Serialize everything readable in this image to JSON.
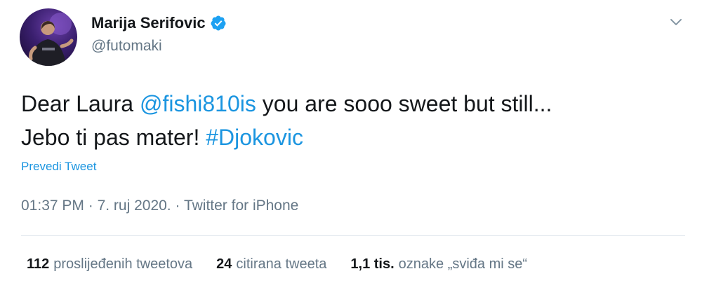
{
  "author": {
    "display_name": "Marija Serifovic",
    "handle": "@futomaki",
    "verified": true
  },
  "tweet": {
    "text_parts": [
      {
        "text": "Dear Laura ",
        "type": "text"
      },
      {
        "text": "@fishi810is",
        "type": "mention"
      },
      {
        "text": " you are sooo sweet but still...",
        "type": "text"
      },
      {
        "text": "Jebo ti pas mater! ",
        "type": "text"
      },
      {
        "text": "#Djokovic",
        "type": "hashtag"
      }
    ],
    "translate_label": "Prevedi Tweet",
    "time": "01:37 PM",
    "date": "7. ruj 2020.",
    "source": "Twitter for iPhone"
  },
  "stats": {
    "retweets_count": "112",
    "retweets_label": "proslijeđenih tweetova",
    "quotes_count": "24",
    "quotes_label": "citirana tweeta",
    "likes_count": "1,1 tis.",
    "likes_label": "oznake „sviđa mi se“"
  },
  "colors": {
    "link": "#1b95e0",
    "secondary_text": "#657786",
    "primary_text": "#14171a",
    "verified_badge": "#1da1f2"
  },
  "icons": {
    "verified": "verified-badge-icon",
    "more": "chevron-down-icon"
  }
}
